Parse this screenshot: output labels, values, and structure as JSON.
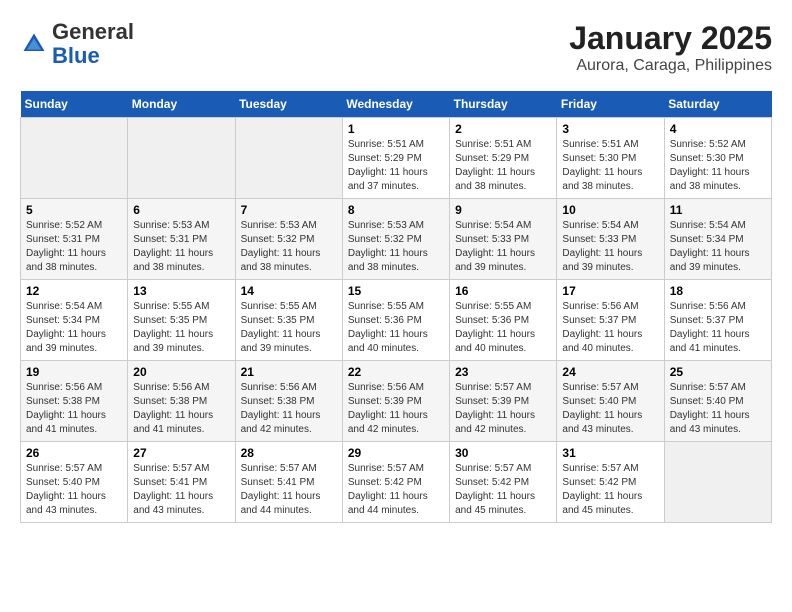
{
  "header": {
    "logo_line1": "General",
    "logo_line2": "Blue",
    "title": "January 2025",
    "subtitle": "Aurora, Caraga, Philippines"
  },
  "weekdays": [
    "Sunday",
    "Monday",
    "Tuesday",
    "Wednesday",
    "Thursday",
    "Friday",
    "Saturday"
  ],
  "weeks": [
    [
      {
        "day": "",
        "info": ""
      },
      {
        "day": "",
        "info": ""
      },
      {
        "day": "",
        "info": ""
      },
      {
        "day": "1",
        "info": "Sunrise: 5:51 AM\nSunset: 5:29 PM\nDaylight: 11 hours and 37 minutes."
      },
      {
        "day": "2",
        "info": "Sunrise: 5:51 AM\nSunset: 5:29 PM\nDaylight: 11 hours and 38 minutes."
      },
      {
        "day": "3",
        "info": "Sunrise: 5:51 AM\nSunset: 5:30 PM\nDaylight: 11 hours and 38 minutes."
      },
      {
        "day": "4",
        "info": "Sunrise: 5:52 AM\nSunset: 5:30 PM\nDaylight: 11 hours and 38 minutes."
      }
    ],
    [
      {
        "day": "5",
        "info": "Sunrise: 5:52 AM\nSunset: 5:31 PM\nDaylight: 11 hours and 38 minutes."
      },
      {
        "day": "6",
        "info": "Sunrise: 5:53 AM\nSunset: 5:31 PM\nDaylight: 11 hours and 38 minutes."
      },
      {
        "day": "7",
        "info": "Sunrise: 5:53 AM\nSunset: 5:32 PM\nDaylight: 11 hours and 38 minutes."
      },
      {
        "day": "8",
        "info": "Sunrise: 5:53 AM\nSunset: 5:32 PM\nDaylight: 11 hours and 38 minutes."
      },
      {
        "day": "9",
        "info": "Sunrise: 5:54 AM\nSunset: 5:33 PM\nDaylight: 11 hours and 39 minutes."
      },
      {
        "day": "10",
        "info": "Sunrise: 5:54 AM\nSunset: 5:33 PM\nDaylight: 11 hours and 39 minutes."
      },
      {
        "day": "11",
        "info": "Sunrise: 5:54 AM\nSunset: 5:34 PM\nDaylight: 11 hours and 39 minutes."
      }
    ],
    [
      {
        "day": "12",
        "info": "Sunrise: 5:54 AM\nSunset: 5:34 PM\nDaylight: 11 hours and 39 minutes."
      },
      {
        "day": "13",
        "info": "Sunrise: 5:55 AM\nSunset: 5:35 PM\nDaylight: 11 hours and 39 minutes."
      },
      {
        "day": "14",
        "info": "Sunrise: 5:55 AM\nSunset: 5:35 PM\nDaylight: 11 hours and 39 minutes."
      },
      {
        "day": "15",
        "info": "Sunrise: 5:55 AM\nSunset: 5:36 PM\nDaylight: 11 hours and 40 minutes."
      },
      {
        "day": "16",
        "info": "Sunrise: 5:55 AM\nSunset: 5:36 PM\nDaylight: 11 hours and 40 minutes."
      },
      {
        "day": "17",
        "info": "Sunrise: 5:56 AM\nSunset: 5:37 PM\nDaylight: 11 hours and 40 minutes."
      },
      {
        "day": "18",
        "info": "Sunrise: 5:56 AM\nSunset: 5:37 PM\nDaylight: 11 hours and 41 minutes."
      }
    ],
    [
      {
        "day": "19",
        "info": "Sunrise: 5:56 AM\nSunset: 5:38 PM\nDaylight: 11 hours and 41 minutes."
      },
      {
        "day": "20",
        "info": "Sunrise: 5:56 AM\nSunset: 5:38 PM\nDaylight: 11 hours and 41 minutes."
      },
      {
        "day": "21",
        "info": "Sunrise: 5:56 AM\nSunset: 5:38 PM\nDaylight: 11 hours and 42 minutes."
      },
      {
        "day": "22",
        "info": "Sunrise: 5:56 AM\nSunset: 5:39 PM\nDaylight: 11 hours and 42 minutes."
      },
      {
        "day": "23",
        "info": "Sunrise: 5:57 AM\nSunset: 5:39 PM\nDaylight: 11 hours and 42 minutes."
      },
      {
        "day": "24",
        "info": "Sunrise: 5:57 AM\nSunset: 5:40 PM\nDaylight: 11 hours and 43 minutes."
      },
      {
        "day": "25",
        "info": "Sunrise: 5:57 AM\nSunset: 5:40 PM\nDaylight: 11 hours and 43 minutes."
      }
    ],
    [
      {
        "day": "26",
        "info": "Sunrise: 5:57 AM\nSunset: 5:40 PM\nDaylight: 11 hours and 43 minutes."
      },
      {
        "day": "27",
        "info": "Sunrise: 5:57 AM\nSunset: 5:41 PM\nDaylight: 11 hours and 43 minutes."
      },
      {
        "day": "28",
        "info": "Sunrise: 5:57 AM\nSunset: 5:41 PM\nDaylight: 11 hours and 44 minutes."
      },
      {
        "day": "29",
        "info": "Sunrise: 5:57 AM\nSunset: 5:42 PM\nDaylight: 11 hours and 44 minutes."
      },
      {
        "day": "30",
        "info": "Sunrise: 5:57 AM\nSunset: 5:42 PM\nDaylight: 11 hours and 45 minutes."
      },
      {
        "day": "31",
        "info": "Sunrise: 5:57 AM\nSunset: 5:42 PM\nDaylight: 11 hours and 45 minutes."
      },
      {
        "day": "",
        "info": ""
      }
    ]
  ]
}
